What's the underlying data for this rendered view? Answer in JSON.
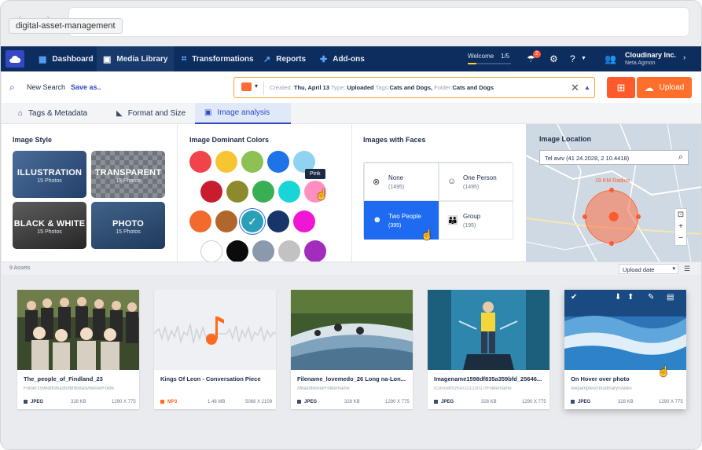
{
  "browser": {
    "tooltip": "digital-asset-management"
  },
  "nav": {
    "items": [
      {
        "label": "Dashboard",
        "icon": "grid-icon"
      },
      {
        "label": "Media Library",
        "icon": "image-icon"
      },
      {
        "label": "Transformations",
        "icon": "transform-icon"
      },
      {
        "label": "Reports",
        "icon": "chart-icon"
      },
      {
        "label": "Add-ons",
        "icon": "puzzle-icon"
      }
    ],
    "active": "Media Library",
    "welcome": "Welcome",
    "welcome_count": "1/5",
    "welcome_progress": 0.2,
    "notifications": "2",
    "account_name": "Cloudinary Inc.",
    "account_user": "Neta Agmon"
  },
  "toolbar": {
    "new_search": "New Search",
    "save_as": "Save as..",
    "query": {
      "created_label": "Created:",
      "created_value": "Thu, April 13",
      "type_label": "Type:",
      "type_value": "Uploaded",
      "tags_label": "Tags:",
      "tags_value": "Cats and Dogs,",
      "folder_label": "Folder:",
      "folder_value": "Cats and Dogs"
    },
    "upload": "Upload"
  },
  "tabs": [
    {
      "label": "Tags & Metadata"
    },
    {
      "label": "Format and Size"
    },
    {
      "label": "Image analysis"
    }
  ],
  "active_tab": "Image analysis",
  "image_style": {
    "title": "Image Style",
    "tiles": [
      {
        "label": "ILLUSTRATION",
        "count": "15 Photos"
      },
      {
        "label": "TRANSPARENT",
        "count": "15 Photos"
      },
      {
        "label": "BLACK & WHITE",
        "count": "15 Photos"
      },
      {
        "label": "PHOTO",
        "count": "15 Photos"
      }
    ]
  },
  "dominant_colors": {
    "title": "Image Dominant Colors",
    "tooltip": "Pink",
    "selected_index": 12,
    "hovered_index": 9,
    "rows": [
      [
        "#f0434a",
        "#f6c531",
        "#8dc153",
        "#1e73e8",
        "#8fd3f0"
      ],
      [
        "#c81d2f",
        "#8c8a2c",
        "#3aae54",
        "#18d5d8",
        "#ff8fbf"
      ],
      [
        "#f26a2c",
        "#b1672c",
        "#2aa0b8",
        "#173568",
        "#ef16d5"
      ],
      [
        "#ffffff",
        "#0b0b0b",
        "#8a9aac",
        "#c2c2c2",
        "#a22cbb"
      ]
    ]
  },
  "faces": {
    "title": "Images with Faces",
    "options": [
      {
        "label": "None",
        "count": "(1495)"
      },
      {
        "label": "One Person",
        "count": "(1495)"
      },
      {
        "label": "Two People",
        "count": "(395)"
      },
      {
        "label": "Group",
        "count": "(195)"
      }
    ],
    "active": "Two People"
  },
  "location": {
    "title": "Image Location",
    "input_value": "Tel aviv (41 24.2028, 2 10.4418)",
    "radius_label": "19 KM Radius"
  },
  "assets_bar": {
    "count": "9 Assets",
    "sort": "Upload date"
  },
  "assets": [
    {
      "name": "The_people_of_Findland_23",
      "path": "Folder1598df835a359bfd58asl/Benel/Folde",
      "format": "JPEG",
      "size": "328 KB",
      "dims": "1290 X 775"
    },
    {
      "name": "Kings Of Leon - Conversation Piece",
      "path": "",
      "format": "MP3",
      "size": "1.46 MB",
      "dims": "5068 X 2109"
    },
    {
      "name": "Filename_lovemedo_26 Long na-Lon...",
      "path": "/98asl/Benel/Foldername",
      "format": "JPEG",
      "size": "328 KB",
      "dims": "1290 X 775"
    },
    {
      "name": "Imagename1598df835a359bfd_25646...",
      "path": "/Concert/USA/22122017/Foldername",
      "format": "JPEG",
      "size": "328 KB",
      "dims": "1290 X 775"
    },
    {
      "name": "On Hover over photo",
      "path": "/eepamples/cloudinary/states",
      "format": "JPEG",
      "size": "328 KB",
      "dims": "1290 X 775"
    }
  ],
  "colors": {
    "nav": "#0d2d5e",
    "accent": "#3448c5",
    "orange": "#ff6f2c"
  }
}
